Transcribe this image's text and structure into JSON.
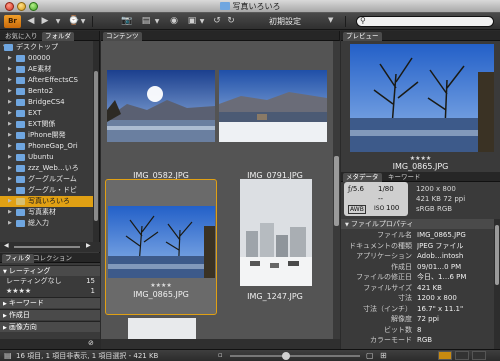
{
  "window": {
    "title": "写真いろいろ",
    "workspace_label": "初期設定",
    "search_placeholder": ""
  },
  "app_logo": "Br",
  "left_panel": {
    "tabs": [
      "お気に入り",
      "フォルダ"
    ],
    "active_tab": "フォルダ",
    "tree": [
      {
        "label": "デスクトップ",
        "level": 0,
        "expanded": true
      },
      {
        "label": "00000",
        "level": 1
      },
      {
        "label": "AE素材",
        "level": 1
      },
      {
        "label": "AfterEffectsCS",
        "level": 1
      },
      {
        "label": "Bento2",
        "level": 1
      },
      {
        "label": "BridgeCS4",
        "level": 1
      },
      {
        "label": "EXT",
        "level": 1
      },
      {
        "label": "EXT関係",
        "level": 1
      },
      {
        "label": "iPhone開発",
        "level": 1
      },
      {
        "label": "PhoneGap_Ori",
        "level": 1
      },
      {
        "label": "Ubuntu",
        "level": 1
      },
      {
        "label": "zzz_Web…いろ",
        "level": 1
      },
      {
        "label": "グーグルズーム",
        "level": 1
      },
      {
        "label": "グーグル・ドビ",
        "level": 1
      },
      {
        "label": "写真いろいろ",
        "level": 1,
        "selected": true
      },
      {
        "label": "写真素材",
        "level": 1
      },
      {
        "label": "総入力",
        "level": 1
      }
    ],
    "filter_tabs": [
      "フィルタ",
      "コレクション"
    ],
    "filter_sections": [
      {
        "label": "レーティング",
        "expanded": true,
        "rows": [
          {
            "label": "レーティングなし",
            "count": "15"
          },
          {
            "label": "★★★★",
            "count": "1"
          }
        ]
      },
      {
        "label": "キーワード"
      },
      {
        "label": "作成日"
      },
      {
        "label": "画像方向"
      }
    ]
  },
  "content": {
    "tab": "コンテンツ",
    "items": [
      {
        "name": "IMG_0582.JPG",
        "stars": "",
        "selected": false
      },
      {
        "name": "IMG_0791.JPG",
        "stars": "",
        "selected": false
      },
      {
        "name": "IMG_0865.JPG",
        "stars": "★★★★",
        "selected": true
      },
      {
        "name": "IMG_1247.JPG",
        "stars": "",
        "selected": false
      }
    ]
  },
  "preview": {
    "tab": "プレビュー",
    "name": "IMG_0865.JPG",
    "stars": "★★★★"
  },
  "metadata": {
    "tabs": [
      "メタデータ",
      "キーワード"
    ],
    "aperture": "ƒ/5.6",
    "shutter": "1/80",
    "exp_comp": "--",
    "iso_label": "ISO",
    "iso": "100",
    "awb": "AWB",
    "dimensions": "1200 x 800",
    "size_res": "421 KB   72 ppi",
    "color": "sRGB    RGB",
    "section": "ファイルプロパティ",
    "props": [
      {
        "key": "ファイル名",
        "value": "IMG_0865.JPG"
      },
      {
        "key": "ドキュメントの種類",
        "value": "JPEG ファイル"
      },
      {
        "key": "アプリケーション",
        "value": "Adob…intosh"
      },
      {
        "key": "作成日",
        "value": "09/01…0 PM"
      },
      {
        "key": "ファイルの修正日",
        "value": "今日、1…6 PM"
      },
      {
        "key": "ファイルサイズ",
        "value": "421 KB"
      },
      {
        "key": "寸法",
        "value": "1200 x 800"
      },
      {
        "key": "寸法（インチ）",
        "value": "16.7\" x 11.1\""
      },
      {
        "key": "解像度",
        "value": "72 ppi"
      },
      {
        "key": "ビット数",
        "value": "8"
      },
      {
        "key": "カラーモード",
        "value": "RGB"
      }
    ]
  },
  "status": {
    "text": "16 項目, 1 項目非表示, 1 項目選択 - 421 KB"
  },
  "colors": {
    "accent": "#e0a014",
    "panel": "#3a3a3a",
    "content_bg": "#545454"
  }
}
